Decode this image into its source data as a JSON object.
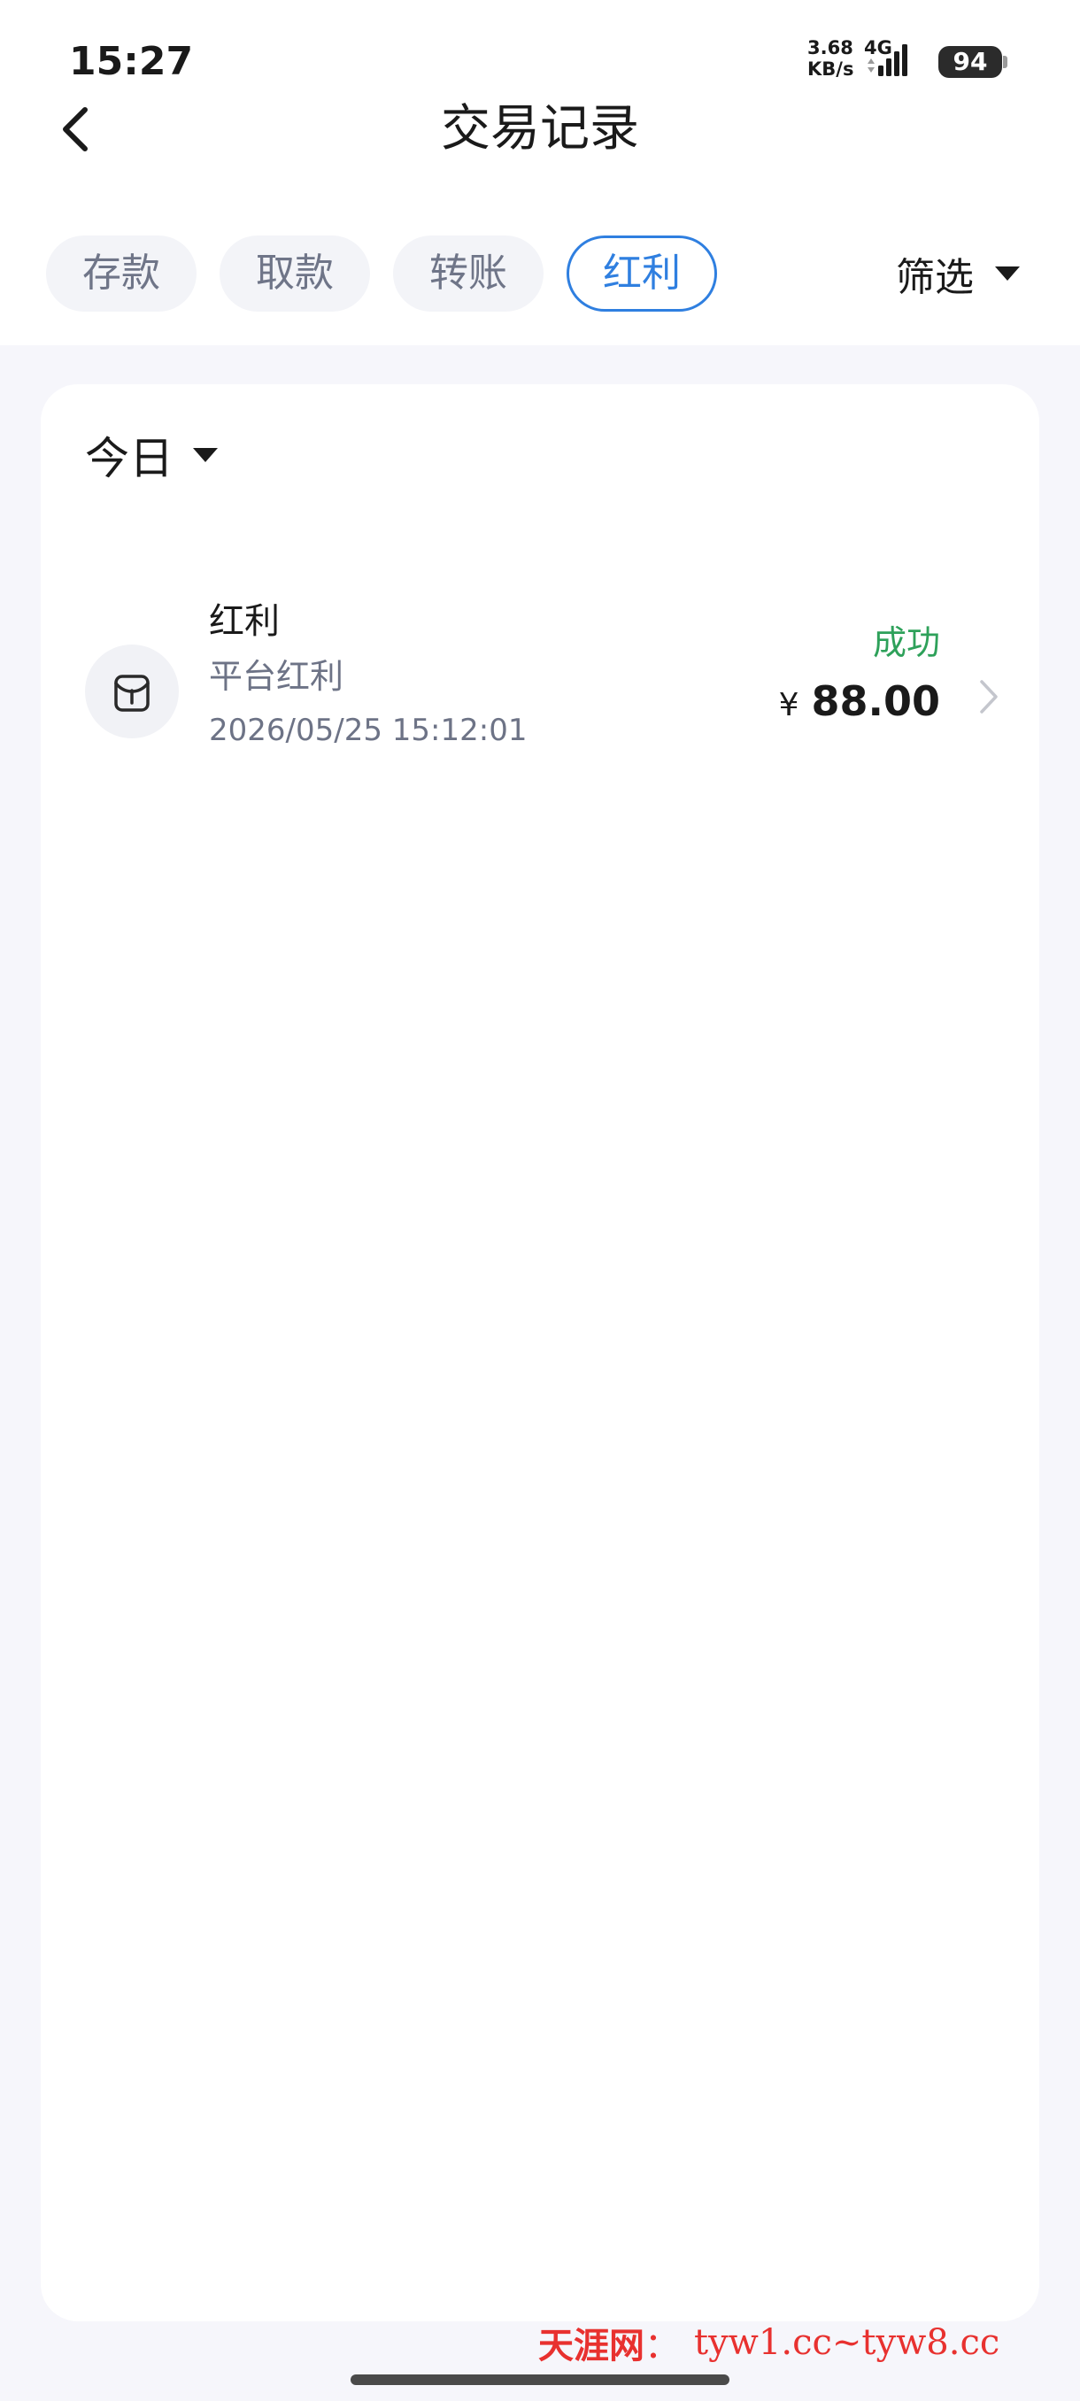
{
  "status_bar": {
    "time": "15:27",
    "net_speed": "3.68\nKB/s",
    "net_type": "4G",
    "battery": "94"
  },
  "header": {
    "title": "交易记录",
    "back_icon": "chevron-left-icon"
  },
  "tabs": [
    {
      "label": "存款",
      "active": false
    },
    {
      "label": "取款",
      "active": false
    },
    {
      "label": "转账",
      "active": false
    },
    {
      "label": "红利",
      "active": true
    }
  ],
  "filter": {
    "label": "筛选",
    "icon": "caret-down-icon"
  },
  "date_filter": {
    "label": "今日",
    "icon": "caret-down-icon"
  },
  "records": [
    {
      "icon": "bonus-pouch-icon",
      "type": "红利",
      "description": "平台红利",
      "datetime": "2026/05/25 15:12:01",
      "status": "成功",
      "currency": "¥",
      "amount": "88.00"
    }
  ],
  "watermark": {
    "name": "天涯网",
    "separator": "：",
    "url": "tyw1.cc~tyw8.cc"
  },
  "colors": {
    "accent": "#2f7fe0",
    "success": "#2ea15a",
    "page_bg": "#f6f6fb",
    "watermark": "#e8312f"
  }
}
